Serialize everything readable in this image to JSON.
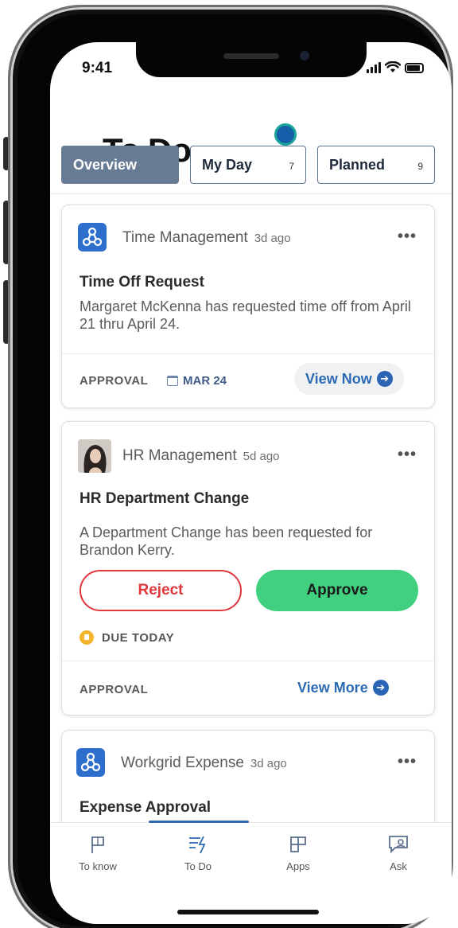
{
  "status_bar": {
    "time": "9:41"
  },
  "header": {
    "title": "To Do"
  },
  "tabs": [
    {
      "label": "Overview",
      "count": ""
    },
    {
      "label": "My Day",
      "count": "7"
    },
    {
      "label": "Planned",
      "count": "9"
    }
  ],
  "cards": [
    {
      "source": "Time Management",
      "ago": "3d ago",
      "title": "Time Off Request",
      "body": "Margaret McKenna has requested time off from April 21 thru April 24.",
      "tag": "APPROVAL",
      "date": "MAR 24",
      "action": "View Now"
    },
    {
      "source": "HR Management",
      "ago": "5d ago",
      "title": "HR Department Change",
      "body": "A Department Change has been requested for Brandon Kerry.",
      "reject": "Reject",
      "approve": "Approve",
      "due": "DUE TODAY",
      "tag": "APPROVAL",
      "action": "View More"
    },
    {
      "source": "Workgrid Expense",
      "ago": "3d ago",
      "title": "Expense Approval"
    }
  ],
  "bottom_nav": [
    {
      "label": "To know",
      "icon": "flag-icon"
    },
    {
      "label": "To Do",
      "icon": "todo-icon"
    },
    {
      "label": "Apps",
      "icon": "apps-icon"
    },
    {
      "label": "Ask",
      "icon": "ask-icon"
    }
  ],
  "colors": {
    "accent": "#2d69b3",
    "tab_active": "#687b94",
    "reject": "#e0373d",
    "approve": "#41d07f",
    "due_flag": "#f3b52b"
  }
}
